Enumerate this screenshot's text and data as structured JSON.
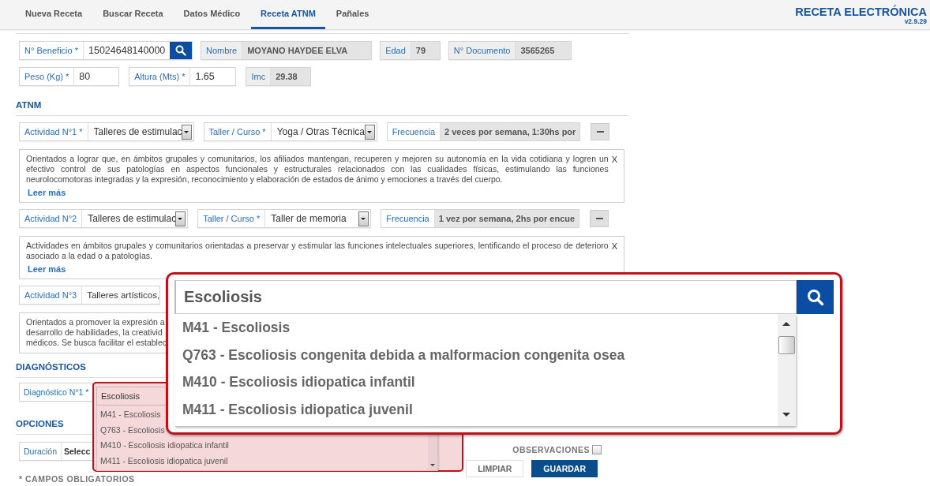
{
  "nav": {
    "tabs": [
      {
        "label": "Nueva Receta",
        "selected": false
      },
      {
        "label": "Buscar Receta",
        "selected": false
      },
      {
        "label": "Datos Médico",
        "selected": false
      },
      {
        "label": "Receta ATNM",
        "selected": true
      },
      {
        "label": "Pañales",
        "selected": false
      }
    ],
    "brand": "RECETA ELECTRÓNICA",
    "version": "v2.9.29"
  },
  "patient": {
    "identity": [
      {
        "label": "N° Beneficio *",
        "value": "15024648140000",
        "kind": "search"
      },
      {
        "label": "Nombre",
        "value": "MOYANO HAYDEE ELVA",
        "kind": "readonly"
      },
      {
        "label": "Edad",
        "value": "79",
        "kind": "readonly"
      },
      {
        "label": "N° Documento",
        "value": "3565265",
        "kind": "readonly"
      }
    ],
    "measures": [
      {
        "label": "Peso (Kg) *",
        "value": "80",
        "kind": "input"
      },
      {
        "label": "Altura (Mts) *",
        "value": "1.65",
        "kind": "input"
      },
      {
        "label": "Imc",
        "value": "29.38",
        "kind": "readonly"
      }
    ]
  },
  "atnm": {
    "heading": "ATNM",
    "activities": [
      {
        "label": "Actividad N°1 *",
        "activity": "Talleres de estimulac",
        "taller_label": "Taller / Curso *",
        "taller": "Yoga  /  Otras Técnica",
        "frecuencia_label": "Frecuencia",
        "frecuencia": "2 veces por semana, 1:30hs por",
        "description": "Orientados a lograr que, en ámbitos grupales y comunitarios, los afiliados mantengan, recuperen y mejoren su autonomía en la vida cotidiana y logren un efectivo control de sus patologías en aspectos funcionales y estructurales relacionados con las cualidades físicas, estimulando las funciones neurolocomotoras integradas y la expresión, reconocimiento y elaboración de estados de ánimo y emociones a través del cuerpo.",
        "close": "X",
        "read_more": "Leer más"
      },
      {
        "label": "Actividad N°2",
        "activity": "Talleres de estimulac",
        "taller_label": "Taller / Curso *",
        "taller": "Taller de memoria",
        "frecuencia_label": "Frecuencia",
        "frecuencia": "1 vez por semana, 2hs por encue",
        "description": "Actividades en ámbitos grupales y comunitarios orientadas a preservar y estimular las funciones intelectuales superiores, lentificando el proceso de deterioro asociado a la edad o a patologías.",
        "close": "X",
        "read_more": "Leer más"
      },
      {
        "label": "Actividad N°3",
        "activity": "Talleres artísticos,",
        "visible_lines": [
          "Orientados a promover la expresión a",
          "desarrollo de habilidades, la creativid",
          "médicos. Se busca facilitar el establec"
        ]
      }
    ]
  },
  "diagnosticos": {
    "heading": "DIAGNÓSTICOS",
    "label": "Diagnóstico N°1 *"
  },
  "opciones": {
    "heading": "OPCIONES",
    "duration_label": "Duración",
    "duration_value": "Selecc",
    "required_note": "* CAMPOS OBLIGATORIOS"
  },
  "observaciones": {
    "label": "OBSERVACIONES",
    "checked": false
  },
  "buttons": [
    {
      "label": "LIMPIAR",
      "kind": "secondary"
    },
    {
      "label": "GUARDAR",
      "kind": "primary"
    }
  ],
  "dropdown": {
    "query": "Escoliosis",
    "options": [
      "M41 - Escoliosis",
      "Q763 - Escoliosis",
      "M410 - Escoliosis idiopatica infantil",
      "M411 - Escoliosis idiopatica juvenil"
    ]
  },
  "callout": {
    "query": "Escoliosis",
    "options": [
      "M41 - Escoliosis",
      "Q763 - Escoliosis congenita debida a malformacion congenita osea",
      "M410 - Escoliosis idiopatica infantil",
      "M411 - Escoliosis idiopatica juvenil"
    ]
  }
}
